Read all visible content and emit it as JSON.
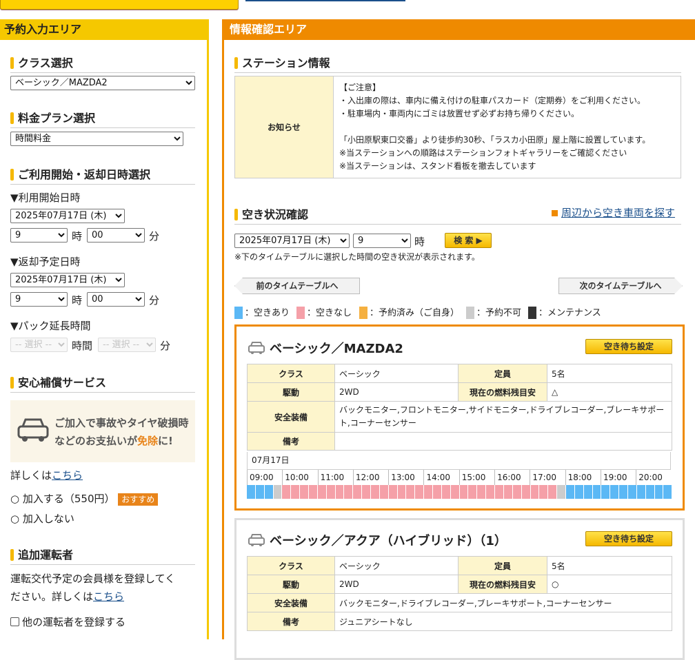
{
  "left": {
    "header": "予約入力エリア",
    "class_section": "クラス選択",
    "class_value": "ベーシック／MAZDA2",
    "plan_section": "料金プラン選択",
    "plan_value": "時間料金",
    "datetime_section": "ご利用開始・返却日時選択",
    "start_label": "▼利用開始日時",
    "start_date": "2025年07月17日 (木)",
    "start_hour": "9",
    "start_min": "00",
    "hour_unit": "時",
    "min_unit": "分",
    "return_label": "▼返却予定日時",
    "return_date": "2025年07月17日 (木)",
    "return_hour": "9",
    "return_min": "00",
    "pack_label": "▼パック延長時間",
    "pack_placeholder": "-- 選択 --",
    "pack_hour_unit": "時間",
    "insurance_section": "安心補償サービス",
    "insurance_line1": "ご加入で事故やタイヤ破損時",
    "insurance_line2a": "などのお支払いが",
    "insurance_line2b": "免除",
    "insurance_line2c": "に!",
    "details_prefix": "詳しくは",
    "details_link": "こちら",
    "join_option": "加入する（550円）",
    "recommend_badge": "おすすめ",
    "no_join_option": "加入しない",
    "driver_section": "追加運転者",
    "driver_text1": "運転交代予定の会員様を登録してく",
    "driver_text2": "ださい。詳しくは",
    "driver_link": "こちら",
    "driver_checkbox": "他の運転者を登録する"
  },
  "right": {
    "header": "情報確認エリア",
    "station_section": "ステーション情報",
    "notice_label": "お知らせ",
    "notice_lines": [
      "【ご注意】",
      "・入出庫の際は、車内に備え付けの駐車パスカード（定期券）をご利用ください。",
      "・駐車場内・車両内にゴミは放置せず必ずお持ち帰りください。",
      "",
      "「小田原駅東口交番」より徒歩約30秒、「ラスカ小田原」屋上階に設置しています。",
      "※当ステーションへの順路はステーションフォトギャラリーをご確認ください",
      "※当ステーションは、スタンド看板を撤去しています"
    ],
    "availability_section": "空き状況確認",
    "nearby_link": "周辺から空き車両を探す",
    "search_date": "2025年07月17日 (木)",
    "search_hour": "9",
    "hour_unit": "時",
    "search_button": "検 索 ▶",
    "search_note": "※下のタイムテーブルに選択した時間の空き状況が表示されます。",
    "prev_button": "前のタイムテーブルへ",
    "next_button": "次のタイムテーブルへ",
    "legend": [
      {
        "label": "：空きあり",
        "color": "#5bb8f5"
      },
      {
        "label": "：空きなし",
        "color": "#f5a0a8"
      },
      {
        "label": "：予約済み（ご自身）",
        "color": "#f5b040"
      },
      {
        "label": "：予約不可",
        "color": "#cccccc"
      },
      {
        "label": "：メンテナンス",
        "color": "#333333"
      }
    ],
    "colors": {
      "free": "#5bb8f5",
      "full": "#f5a0a8",
      "na": "#cccccc"
    },
    "cars": [
      {
        "name": "ベーシック／MAZDA2",
        "wait_button": "空き待ち設定",
        "class_label": "クラス",
        "class_value": "ベーシック",
        "capacity_label": "定員",
        "capacity_value": "5名",
        "drive_label": "駆動",
        "drive_value": "2WD",
        "fuel_label": "現在の燃料残目安",
        "fuel_value": "△",
        "safety_label": "安全装備",
        "safety_value": "バックモニター,フロントモニター,サイドモニター,ドライブレコーダー,ブレーキサポート,コーナーセンサー",
        "remarks_label": "備考",
        "remarks_value": "",
        "date": "07月17日",
        "times": [
          "09:00",
          "10:00",
          "11:00",
          "12:00",
          "13:00",
          "14:00",
          "15:00",
          "16:00",
          "17:00",
          "18:00",
          "19:00",
          "20:00"
        ],
        "slots": [
          "free",
          "free",
          "free",
          "na",
          "full",
          "full",
          "full",
          "full",
          "full",
          "full",
          "full",
          "full",
          "full",
          "full",
          "full",
          "full",
          "full",
          "full",
          "full",
          "full",
          "full",
          "full",
          "full",
          "full",
          "full",
          "full",
          "full",
          "full",
          "full",
          "full",
          "full",
          "full",
          "full",
          "full",
          "full",
          "na",
          "free",
          "free",
          "free",
          "free",
          "free",
          "free",
          "free",
          "free",
          "free",
          "free",
          "free",
          "free"
        ]
      },
      {
        "name": "ベーシック／アクア（ハイブリッド）（1）",
        "wait_button": "空き待ち設定",
        "class_label": "クラス",
        "class_value": "ベーシック",
        "capacity_label": "定員",
        "capacity_value": "5名",
        "drive_label": "駆動",
        "drive_value": "2WD",
        "fuel_label": "現在の燃料残目安",
        "fuel_value": "○",
        "safety_label": "安全装備",
        "safety_value": "バックモニター,ドライブレコーダー,ブレーキサポート,コーナーセンサー",
        "remarks_label": "備考",
        "remarks_value": "ジュニアシートなし"
      }
    ]
  }
}
